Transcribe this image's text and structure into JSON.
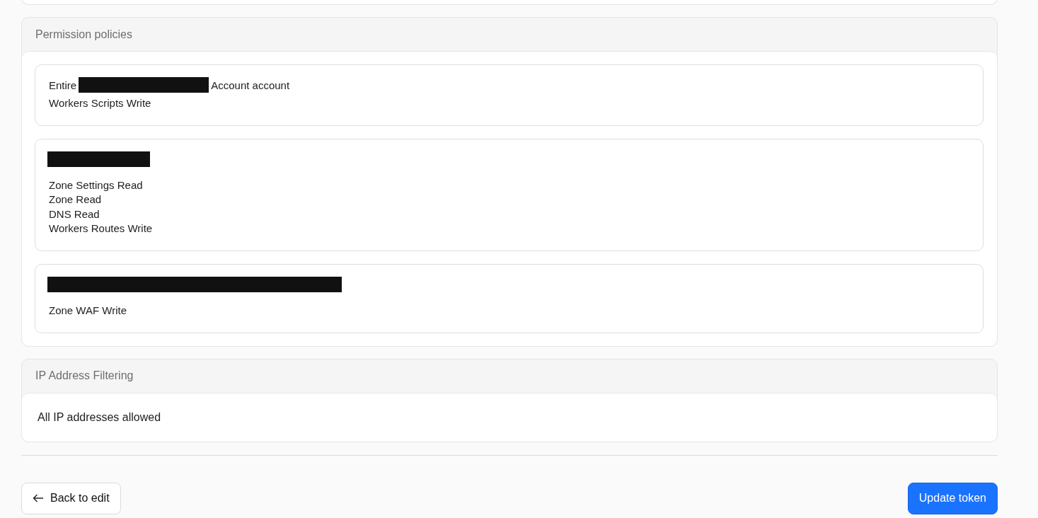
{
  "permission_policies": {
    "title": "Permission policies",
    "policies": [
      {
        "scope": [
          {
            "kind": "text",
            "text": "Entire"
          },
          {
            "kind": "redacted"
          },
          {
            "kind": "text",
            "text": "Account account"
          }
        ],
        "permissions": [
          "Workers Scripts Write"
        ]
      },
      {
        "scope": [
          {
            "kind": "redacted"
          }
        ],
        "permissions": [
          "Zone Settings Read",
          "Zone Read",
          "DNS Read",
          "Workers Routes Write"
        ]
      },
      {
        "scope": [
          {
            "kind": "redacted"
          }
        ],
        "permissions": [
          "Zone WAF Write"
        ]
      }
    ]
  },
  "ip_filtering": {
    "title": "IP Address Filtering",
    "value": "All IP addresses allowed"
  },
  "buttons": {
    "back": "Back to edit",
    "submit": "Update token"
  }
}
